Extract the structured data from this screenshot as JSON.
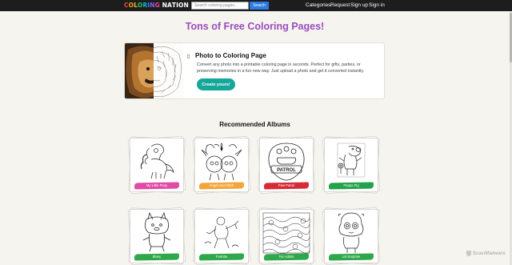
{
  "header": {
    "logo_letters": [
      {
        "char": "C",
        "color": "#ef4444"
      },
      {
        "char": "O",
        "color": "#f59e0b"
      },
      {
        "char": "L",
        "color": "#fbbf24"
      },
      {
        "char": "O",
        "color": "#22c55e"
      },
      {
        "char": "R",
        "color": "#06b6d4"
      },
      {
        "char": "I",
        "color": "#3b82f6"
      },
      {
        "char": "N",
        "color": "#8b5cf6"
      },
      {
        "char": "G",
        "color": "#ec4899"
      },
      {
        "char": " ",
        "color": "#ffffff"
      },
      {
        "char": "N",
        "color": "#ffffff"
      },
      {
        "char": "A",
        "color": "#ffffff"
      },
      {
        "char": "T",
        "color": "#ffffff"
      },
      {
        "char": "I",
        "color": "#ffffff"
      },
      {
        "char": "O",
        "color": "#ffffff"
      },
      {
        "char": "N",
        "color": "#ffffff"
      }
    ],
    "search_placeholder": "Search coloring pages...",
    "search_button": "Search",
    "nav": {
      "categories": "Categories",
      "request": "Request",
      "signup": "Sign up",
      "signin": "Sign in"
    }
  },
  "main": {
    "headline": "Tons of Free Coloring Pages!",
    "promo": {
      "icon": "image-icon",
      "title": "Photo to Coloring Page",
      "description": "Convert any photo into a printable coloring page in seconds. Perfect for gifts, parties, or preserving memories in a fun new way. Just upload a photo and get it converted instantly.",
      "button": "Create yours!"
    },
    "albums_title": "Recommended Albums",
    "albums": [
      {
        "label": "My Little Pony",
        "color": "#e14aa6"
      },
      {
        "label": "Angel And Stitch",
        "color": "#f2a53a"
      },
      {
        "label": "Paw Patrol",
        "color": "#d62a36"
      },
      {
        "label": "Peppa Pig",
        "color": "#22a24a"
      },
      {
        "label": "Bluey",
        "color": "#2fa84a"
      },
      {
        "label": "Fortnite",
        "color": "#2fa84a"
      },
      {
        "label": "For Adults",
        "color": "#2fa84a"
      },
      {
        "label": "Lol Surprise",
        "color": "#2fa84a"
      }
    ]
  },
  "watermark": "ScanMalware"
}
